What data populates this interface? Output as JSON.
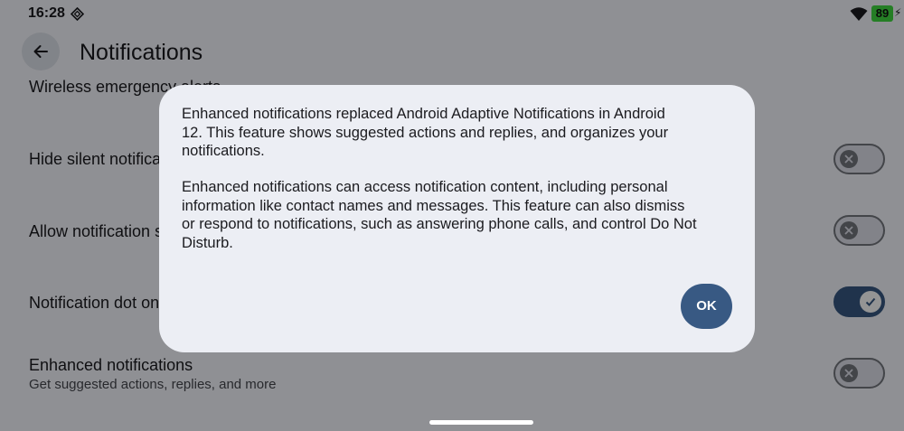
{
  "status_bar": {
    "time": "16:28",
    "battery_level": "89",
    "icons": [
      "diamond-icon",
      "wifi-icon",
      "battery-icon",
      "charging-bolt-icon"
    ]
  },
  "app_bar": {
    "title": "Notifications",
    "back_icon": "arrow-left-icon"
  },
  "settings": [
    {
      "title": "Wireless emergency alerts",
      "subtitle": ""
    },
    {
      "title": "Hide silent notifications in status bar",
      "subtitle": "",
      "toggle": false
    },
    {
      "title": "Allow notification snoozing",
      "subtitle": "",
      "toggle": false
    },
    {
      "title": "Notification dot on app icon",
      "subtitle": "",
      "toggle": true
    },
    {
      "title": "Enhanced notifications",
      "subtitle": "Get suggested actions, replies, and more",
      "toggle": false
    }
  ],
  "dialog": {
    "paragraph_1_lines": [
      "Enhanced notifications replaced Android Adaptive Notifications in Android",
      "12. This feature shows suggested actions and replies, and organizes your",
      "notifications."
    ],
    "paragraph_2_lines": [
      "Enhanced notifications can access notification content, including personal",
      "information like contact names and messages. This feature can also dismiss",
      "or respond to notifications, such as answering phone calls, and control Do Not",
      "Disturb."
    ],
    "ok_label": "OK"
  },
  "colors": {
    "accent": "#385983",
    "dialog_bg": "#eceef4",
    "battery": "#41d941"
  }
}
